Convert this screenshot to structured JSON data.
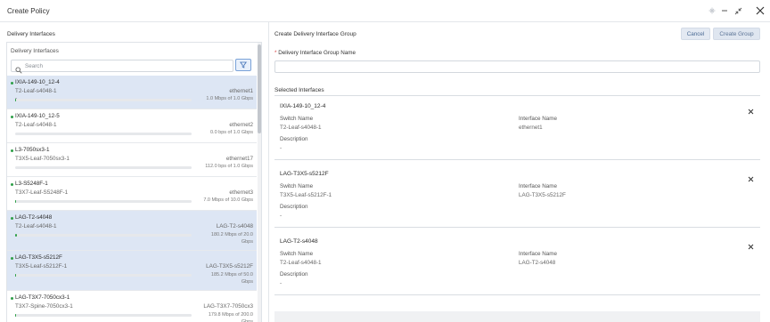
{
  "window": {
    "title": "Create Policy"
  },
  "left_panel": {
    "title": "Delivery Interfaces",
    "box_title": "Delivery Interfaces",
    "search_placeholder": "Search",
    "items": [
      {
        "name": "IXIA-149-10_12-4",
        "switch": "T2-Leaf-s4048-1",
        "switch2": "-",
        "interface": "ethernet1",
        "bandwidth": "1.0 Mbps of 1.0 Gbps",
        "utilization_pct": 0.1,
        "selected": true
      },
      {
        "name": "IXIA-149-10_12-5",
        "switch": "T2-Leaf-s4048-1",
        "interface": "ethernet2",
        "bandwidth": "0.0 bps of 1.0 Gbps",
        "utilization_pct": 0,
        "selected": false
      },
      {
        "name": "L3-7050sx3-1",
        "switch": "T3X5-Leaf-7050sx3-1",
        "interface": "ethernet17",
        "bandwidth": "112.0 bps of 1.0 Gbps",
        "utilization_pct": 0,
        "selected": false
      },
      {
        "name": "L3-S5248F-1",
        "switch": "T3X7-Leaf-S5248F-1",
        "interface": "ethernet3",
        "bandwidth": "7.0 Mbps of 10.0 Gbps",
        "utilization_pct": 0.07,
        "selected": false
      },
      {
        "name": "LAG-T2-s4048",
        "switch": "T2-Leaf-s4048-1",
        "interface": "LAG-T2-s4048",
        "bandwidth": "180.2 Mbps of 20.0 Gbps",
        "utilization_pct": 0.9,
        "selected": true
      },
      {
        "name": "LAG-T3X5-s5212F",
        "switch": "T3X5-Leaf-s5212F-1",
        "interface": "LAG-T3X5-s5212F",
        "bandwidth": "185.2 Mbps of 50.0 Gbps",
        "utilization_pct": 0.37,
        "selected": true
      },
      {
        "name": "LAG-T3X7-7050cx3-1",
        "switch": "T3X7-Spine-7050cx3-1",
        "interface": "LAG-T3X7-7050cx3",
        "bandwidth": "179.8 Mbps of 200.0 Gbps",
        "utilization_pct": 0.09,
        "selected": false
      }
    ]
  },
  "right_panel": {
    "title": "Create Delivery Interface Group",
    "cancel_label": "Cancel",
    "create_label": "Create Group",
    "required_mark": "*",
    "name_label": "Delivery Interface Group Name",
    "name_value": "",
    "selected_label": "Selected Interfaces",
    "labels": {
      "switch_name": "Switch Name",
      "interface_name": "Interface Name",
      "description": "Description"
    },
    "cards": [
      {
        "title": "IXIA-149-10_12-4",
        "switch": "T2-Leaf-s4048-1",
        "interface": "ethernet1",
        "description": "-"
      },
      {
        "title": "LAG-T3X5-s5212F",
        "switch": "T3X5-Leaf-s5212F-1",
        "interface": "LAG-T3X5-s5212F",
        "description": "-"
      },
      {
        "title": "LAG-T2-s4048",
        "switch": "T2-Leaf-s4048-1",
        "interface": "LAG-T2-s4048",
        "description": "-"
      }
    ]
  },
  "colors": {
    "accent": "#4a6a94",
    "status_green": "#2e9f48",
    "selected_row": "#dde6f4"
  },
  "icons": [
    "pin-icon",
    "minimize-icon",
    "collapse-icon",
    "close-icon",
    "search-icon",
    "filter-icon",
    "remove-icon"
  ]
}
